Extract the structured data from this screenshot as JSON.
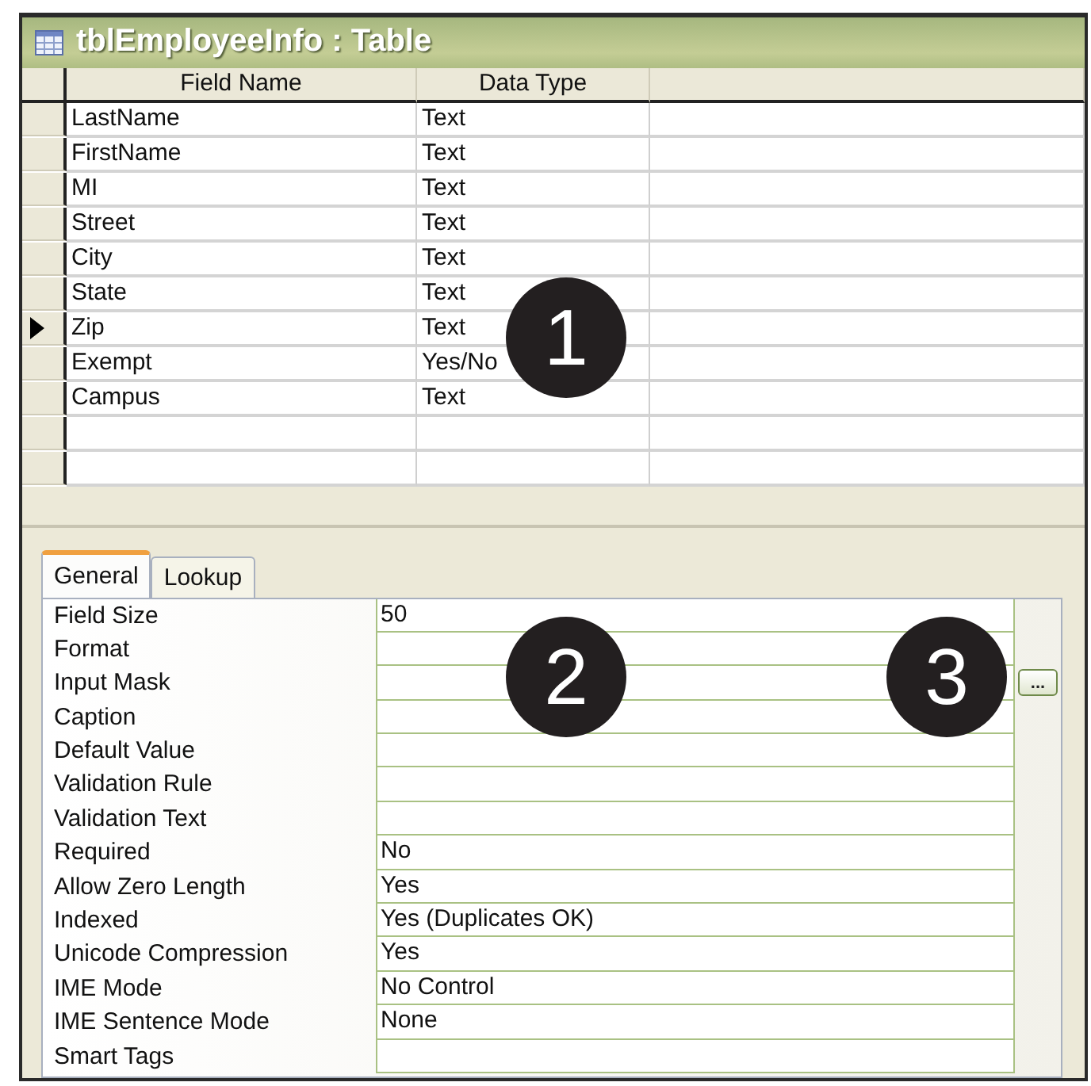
{
  "window": {
    "title": "tblEmployeeInfo : Table"
  },
  "grid": {
    "columns": [
      "Field Name",
      "Data Type"
    ],
    "rows": [
      {
        "field_name": "LastName",
        "data_type": "Text",
        "selected": false
      },
      {
        "field_name": "FirstName",
        "data_type": "Text",
        "selected": false
      },
      {
        "field_name": "MI",
        "data_type": "Text",
        "selected": false
      },
      {
        "field_name": "Street",
        "data_type": "Text",
        "selected": false
      },
      {
        "field_name": "City",
        "data_type": "Text",
        "selected": false
      },
      {
        "field_name": "State",
        "data_type": "Text",
        "selected": false
      },
      {
        "field_name": "Zip",
        "data_type": "Text",
        "selected": true
      },
      {
        "field_name": "Exempt",
        "data_type": "Yes/No",
        "selected": false
      },
      {
        "field_name": "Campus",
        "data_type": "Text",
        "selected": false
      }
    ]
  },
  "tabs": [
    {
      "label": "General",
      "selected": true
    },
    {
      "label": "Lookup",
      "selected": false
    }
  ],
  "properties": [
    {
      "label": "Field Size",
      "value": "50"
    },
    {
      "label": "Format"
    },
    {
      "label": "Input Mask",
      "builder": "..."
    },
    {
      "label": "Caption"
    },
    {
      "label": "Default Value"
    },
    {
      "label": "Validation Rule"
    },
    {
      "label": "Validation Text"
    },
    {
      "label": "Required",
      "value": "No"
    },
    {
      "label": "Allow Zero Length",
      "value": "Yes"
    },
    {
      "label": "Indexed",
      "value": "Yes (Duplicates OK)"
    },
    {
      "label": "Unicode Compression",
      "value": "Yes"
    },
    {
      "label": "IME Mode",
      "value": "No Control"
    },
    {
      "label": "IME Sentence Mode",
      "value": "None"
    },
    {
      "label": "Smart Tags"
    }
  ],
  "callouts": [
    "1",
    "2",
    "3"
  ]
}
